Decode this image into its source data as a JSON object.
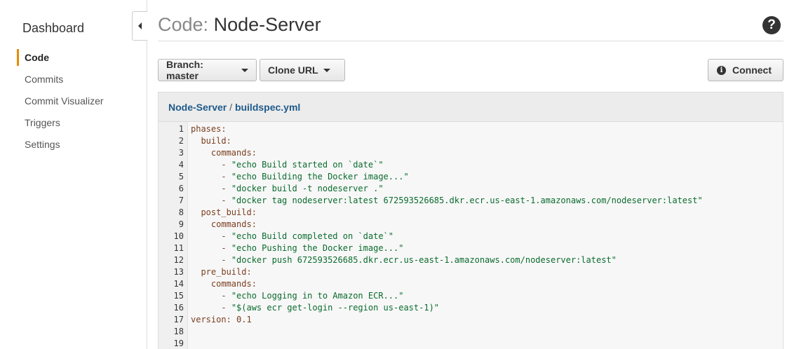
{
  "sidebar": {
    "title": "Dashboard",
    "items": [
      {
        "label": "Code",
        "active": true
      },
      {
        "label": "Commits",
        "active": false
      },
      {
        "label": "Commit Visualizer",
        "active": false
      },
      {
        "label": "Triggers",
        "active": false
      },
      {
        "label": "Settings",
        "active": false
      }
    ],
    "collapse_icon": "chevron-left-icon"
  },
  "header": {
    "title_prefix": "Code:",
    "title": "Node-Server",
    "help_icon": "?"
  },
  "toolbar": {
    "branch_label": "Branch: master",
    "clone_label": "Clone URL",
    "connect_label": "Connect",
    "connect_icon": "i"
  },
  "file": {
    "repo": "Node-Server",
    "separator": "/",
    "name": "buildspec.yml"
  },
  "code_lines": [
    {
      "n": "1",
      "indent": "",
      "key": "phases:",
      "str": ""
    },
    {
      "n": "2",
      "indent": "  ",
      "key": "build:",
      "str": ""
    },
    {
      "n": "3",
      "indent": "    ",
      "key": "commands:",
      "str": ""
    },
    {
      "n": "4",
      "indent": "      ",
      "key": "- ",
      "str": "\"echo Build started on `date`\""
    },
    {
      "n": "5",
      "indent": "      ",
      "key": "- ",
      "str": "\"echo Building the Docker image...\""
    },
    {
      "n": "6",
      "indent": "      ",
      "key": "- ",
      "str": "\"docker build -t nodeserver .\""
    },
    {
      "n": "7",
      "indent": "      ",
      "key": "- ",
      "str": "\"docker tag nodeserver:latest 672593526685.dkr.ecr.us-east-1.amazonaws.com/nodeserver:latest\""
    },
    {
      "n": "8",
      "indent": "  ",
      "key": "post_build:",
      "str": ""
    },
    {
      "n": "9",
      "indent": "    ",
      "key": "commands:",
      "str": ""
    },
    {
      "n": "10",
      "indent": "      ",
      "key": "- ",
      "str": "\"echo Build completed on `date`\""
    },
    {
      "n": "11",
      "indent": "      ",
      "key": "- ",
      "str": "\"echo Pushing the Docker image...\""
    },
    {
      "n": "12",
      "indent": "      ",
      "key": "- ",
      "str": "\"docker push 672593526685.dkr.ecr.us-east-1.amazonaws.com/nodeserver:latest\""
    },
    {
      "n": "13",
      "indent": "  ",
      "key": "pre_build:",
      "str": ""
    },
    {
      "n": "14",
      "indent": "    ",
      "key": "commands:",
      "str": ""
    },
    {
      "n": "15",
      "indent": "      ",
      "key": "- ",
      "str": "\"echo Logging in to Amazon ECR...\""
    },
    {
      "n": "16",
      "indent": "      ",
      "key": "- ",
      "str": "\"$(aws ecr get-login --region us-east-1)\""
    },
    {
      "n": "17",
      "indent": "",
      "key": "version: 0.1",
      "str": ""
    },
    {
      "n": "18",
      "indent": "",
      "key": "",
      "str": ""
    },
    {
      "n": "19",
      "indent": "",
      "key": "",
      "str": ""
    }
  ],
  "colors": {
    "accent": "#e68a00",
    "link": "#1e5a8a",
    "string": "#0a6b2e",
    "keyword": "#7a3e1f"
  }
}
